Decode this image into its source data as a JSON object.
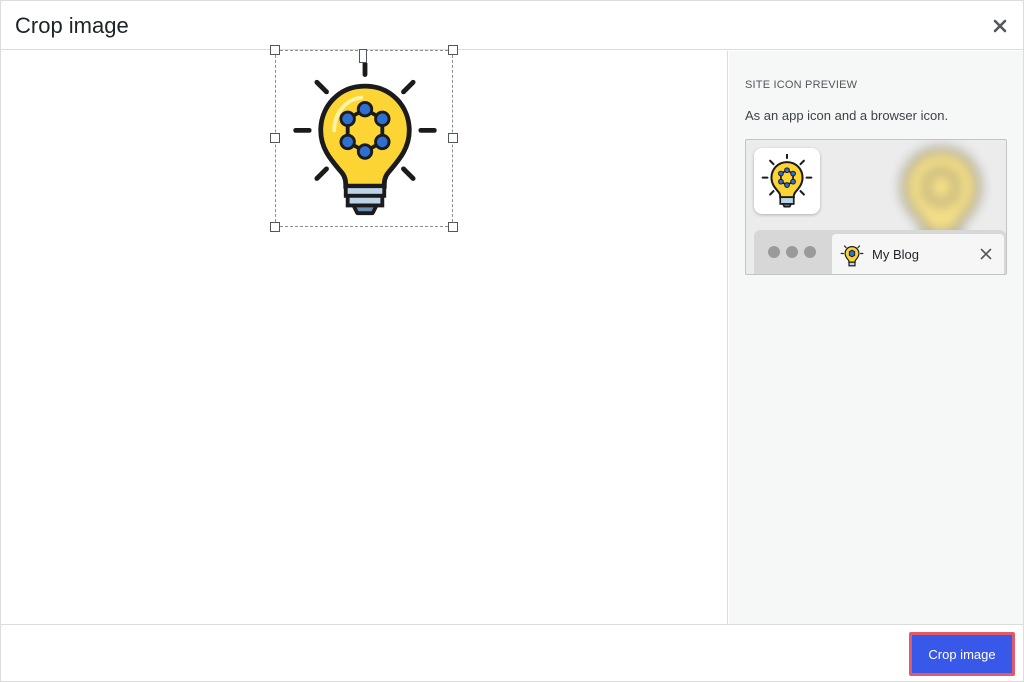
{
  "modal": {
    "title": "Crop image",
    "close_icon": "close-icon"
  },
  "sidebar": {
    "heading": "Site Icon Preview",
    "description": "As an app icon and a browser icon.",
    "browser_tab_title": "My Blog",
    "tab_close_icon": "close-icon"
  },
  "footer": {
    "crop_button_label": "Crop image"
  },
  "colors": {
    "accent": "#3858e9",
    "highlight_border": "#e05a6a",
    "bulb_yellow": "#fcd535",
    "bulb_dark": "#1b1b1b",
    "node_blue": "#2f6fcf"
  },
  "icons": [
    "close-icon",
    "lightbulb-icon",
    "crop-handle-icon"
  ]
}
